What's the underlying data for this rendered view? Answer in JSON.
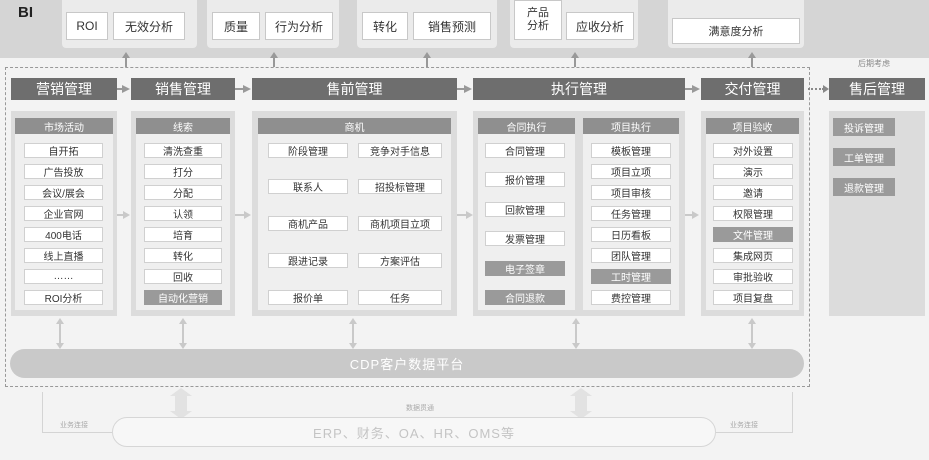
{
  "bi": {
    "label": "BI",
    "buttons": [
      "ROI",
      "无效分析",
      "质量",
      "行为分析",
      "转化",
      "销售预测",
      "产品分析",
      "应收分析",
      "满意度分析"
    ]
  },
  "stages": [
    "营销管理",
    "销售管理",
    "售前管理",
    "执行管理",
    "交付管理"
  ],
  "after_sales": {
    "note": "后期考虑",
    "title": "售后管理",
    "items": [
      "投诉管理",
      "工单管理",
      "退款管理"
    ]
  },
  "marketing": {
    "header": "市场活动",
    "items": [
      "自开拓",
      "广告投放",
      "会议/展会",
      "企业官网",
      "400电话",
      "线上直播",
      "……",
      "ROI分析"
    ]
  },
  "sales": {
    "header": "线索",
    "items": [
      "清洗查重",
      "打分",
      "分配",
      "认领",
      "培育",
      "转化",
      "回收",
      "自动化营销"
    ]
  },
  "presales": {
    "header": "商机",
    "left": [
      "阶段管理",
      "联系人",
      "商机产品",
      "跟进记录",
      "报价单"
    ],
    "right": [
      "竞争对手信息",
      "招投标管理",
      "商机项目立项",
      "方案评估",
      "任务"
    ]
  },
  "execution": {
    "contract": {
      "header": "合同执行",
      "items": [
        "合同管理",
        "报价管理",
        "回款管理",
        "发票管理",
        "电子签章",
        "合同退款"
      ]
    },
    "project": {
      "header": "项目执行",
      "items": [
        "模板管理",
        "项目立项",
        "项目审核",
        "任务管理",
        "日历看板",
        "团队管理",
        "工时管理",
        "费控管理"
      ]
    }
  },
  "delivery": {
    "header": "项目验收",
    "items": [
      "对外设置",
      "演示",
      "邀请",
      "权限管理",
      "文件管理",
      "集成网页",
      "审批验收",
      "项目复盘"
    ]
  },
  "cdp": "CDP客户数据平台",
  "erp": "ERP、财务、OA、HR、OMS等",
  "labels": {
    "data_link": "数据贯通",
    "business_left": "业务连接",
    "business_right": "业务连接"
  }
}
